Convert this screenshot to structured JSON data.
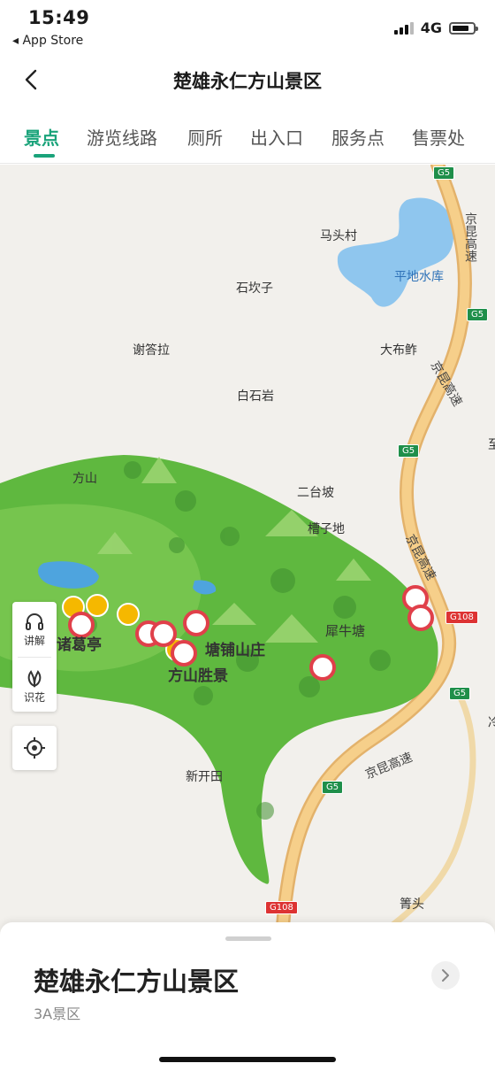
{
  "status_bar": {
    "time": "15:49",
    "back_app": "◂ App Store",
    "network": "4G"
  },
  "nav": {
    "title": "楚雄永仁方山景区"
  },
  "tabs": [
    {
      "label": "景点",
      "active": true
    },
    {
      "label": "游览线路",
      "active": false
    },
    {
      "label": "厕所",
      "active": false
    },
    {
      "label": "出入口",
      "active": false
    },
    {
      "label": "服务点",
      "active": false
    },
    {
      "label": "售票处",
      "active": false
    }
  ],
  "map": {
    "places": {
      "matoucun": "马头村",
      "pingdi_reservoir": "平地水库",
      "shikanzi": "石坎子",
      "xiedala": "谢答拉",
      "dabuzuo": "大布鲊",
      "baishiyan": "白石岩",
      "fangshan": "方山",
      "ertaipo": "二台坡",
      "caozidi": "槽子地",
      "xiniutang": "犀牛塘",
      "tangpu_shanzhuang": "塘铺山庄",
      "fangshan_shengjing": "方山胜景",
      "zhuge_ting": "诸葛亭",
      "xinkaitian": "新开田",
      "zhantou": "箐头",
      "edge1": "至",
      "edge2": "冷"
    },
    "roads": {
      "jingkun_1": "京昆高速",
      "jingkun_2": "京昆高速",
      "jingkun_3": "京昆高速",
      "jingkun_4": "京昆高速",
      "g5": "G5",
      "g108": "G108"
    }
  },
  "side_controls": {
    "guide_label": "讲解",
    "flower_label": "识花"
  },
  "sheet": {
    "title": "楚雄永仁方山景区",
    "subtitle": "3A景区"
  },
  "colors": {
    "accent": "#1aa37a",
    "park_green": "#5fb83f",
    "marker_red": "#e0404a",
    "marker_yellow": "#f5b800"
  }
}
